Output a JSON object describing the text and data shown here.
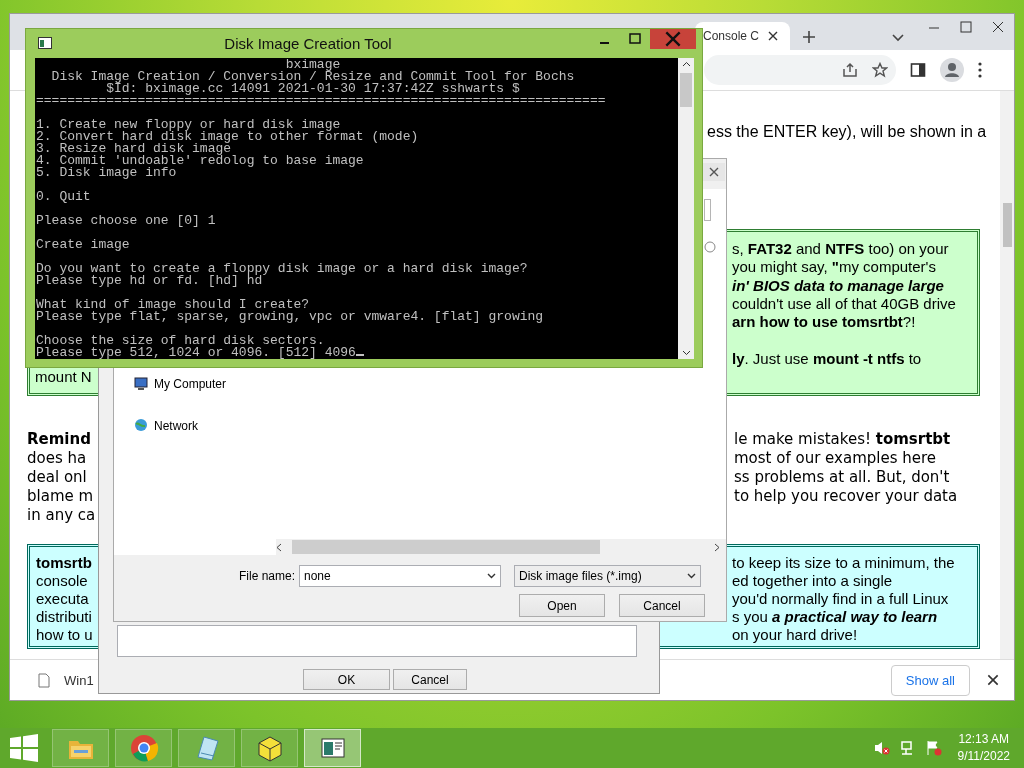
{
  "browser": {
    "tabs": [
      {
        "title": "Console C",
        "selected": true
      }
    ],
    "page": {
      "intro": "ess the ENTER key), will be shown in a",
      "green_box": {
        "left": [
          "mount N"
        ],
        "right": [
          {
            "text": "s, **FAT32** and **NTFS** too) on your",
            "kind": "plain"
          },
          {
            "text": "you might say, **\"**my computer's",
            "kind": "plain"
          },
          {
            "text": "**in' BIOS data to manage large**",
            "kind": "accent"
          },
          {
            "text": "couldn't use all of that 40GB drive",
            "kind": "plain"
          },
          {
            "text": "**arn how to use tomsrtbt**?!",
            "kind": "plain"
          },
          {
            "text": "**ly**. Just use **mount -t ntfs** to",
            "kind": "plain"
          }
        ]
      },
      "reminder": {
        "left": [
          "**Remind**",
          "does ha",
          "deal onl",
          "blame m",
          "in any ca"
        ],
        "right": [
          "le make mistakes! **tomsrtbt**",
          "most of our examples here",
          "ss problems at all. But, don't",
          "to help you recover your data"
        ]
      },
      "cyan_box": {
        "left": [
          "**tomsrtb**",
          "console",
          "executa",
          "distributi",
          "how to u"
        ],
        "right": [
          {
            "text": "to keep its size to a minimum, the",
            "kind": "plain"
          },
          {
            "text": "ed together into a single",
            "kind": "plain"
          },
          {
            "text": "you'd normally find in a full Linux",
            "kind": "plain"
          },
          {
            "text": "s you **a practical way to learn**",
            "kind": "accent"
          },
          {
            "text": "on your hard drive!",
            "kind": "plain"
          }
        ]
      }
    },
    "downloads": {
      "file": "Win1",
      "show_all": "Show all"
    }
  },
  "parent_dialog": {
    "ok": "OK",
    "cancel": "Cancel"
  },
  "file_dialog": {
    "places": [
      {
        "label": "My Computer",
        "kind": "computer"
      },
      {
        "label": "Network",
        "kind": "network"
      }
    ],
    "file_name_label": "File name:",
    "file_name": "none",
    "file_type": "Disk image files (*.img)",
    "open": "Open",
    "cancel": "Cancel"
  },
  "console": {
    "title": "Disk Image Creation Tool",
    "text": "                                bximage\n  Disk Image Creation / Conversion / Resize and Commit Tool for Bochs\n         $Id: bximage.cc 14091 2021-01-30 17:37:42Z sshwarts $\n=========================================================================\n\n1. Create new floppy or hard disk image\n2. Convert hard disk image to other format (mode)\n3. Resize hard disk image\n4. Commit 'undoable' redolog to base image\n5. Disk image info\n\n0. Quit\n\nPlease choose one [0] 1\n\nCreate image\n\nDo you want to create a floppy disk image or a hard disk image?\nPlease type hd or fd. [hd] hd\n\nWhat kind of image should I create?\nPlease type flat, sparse, growing, vpc or vmware4. [flat] growing\n\nChoose the size of hard disk sectors.\nPlease type 512, 1024 or 4096. [512] 4096"
  },
  "taskbar": {
    "apps": [
      {
        "kind": "folder",
        "selected": false
      },
      {
        "kind": "chrome",
        "selected": false
      },
      {
        "kind": "notepad",
        "selected": false
      },
      {
        "kind": "package",
        "selected": false
      },
      {
        "kind": "window",
        "selected": true
      }
    ],
    "time": "12:13 AM",
    "date": "9/11/2022"
  }
}
